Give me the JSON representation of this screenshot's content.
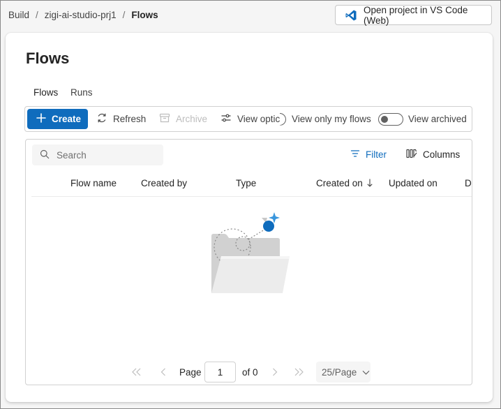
{
  "breadcrumb": {
    "items": [
      "Build",
      "zigi-ai-studio-prj1",
      "Flows"
    ],
    "separator": "/"
  },
  "header": {
    "vscode_button_label": "Open project in VS Code (Web)",
    "vscode_icon": "vscode-icon"
  },
  "page": {
    "title": "Flows",
    "tabs": [
      {
        "label": "Flows",
        "active": true
      },
      {
        "label": "Runs",
        "active": false
      }
    ]
  },
  "toolbar": {
    "create_label": "Create",
    "refresh_label": "Refresh",
    "archive_label": "Archive",
    "view_options_label": "View optic",
    "view_only_my_flows_label": "View only my flows",
    "view_archived_label": "View archived",
    "view_archived_on": false
  },
  "table": {
    "search_placeholder": "Search",
    "filter_label": "Filter",
    "columns_label": "Columns",
    "columns": [
      "Flow name",
      "Created by",
      "Type",
      "Created on",
      "Updated on",
      "Da"
    ],
    "sort_column": "Created on",
    "sort_direction": "descending",
    "rows": []
  },
  "pagination": {
    "page_label": "Page",
    "current_page": "1",
    "of_label": "of 0",
    "per_page": "25/Page"
  },
  "colors": {
    "accent": "#0f6cbd",
    "disabled": "#bdbdbd"
  }
}
